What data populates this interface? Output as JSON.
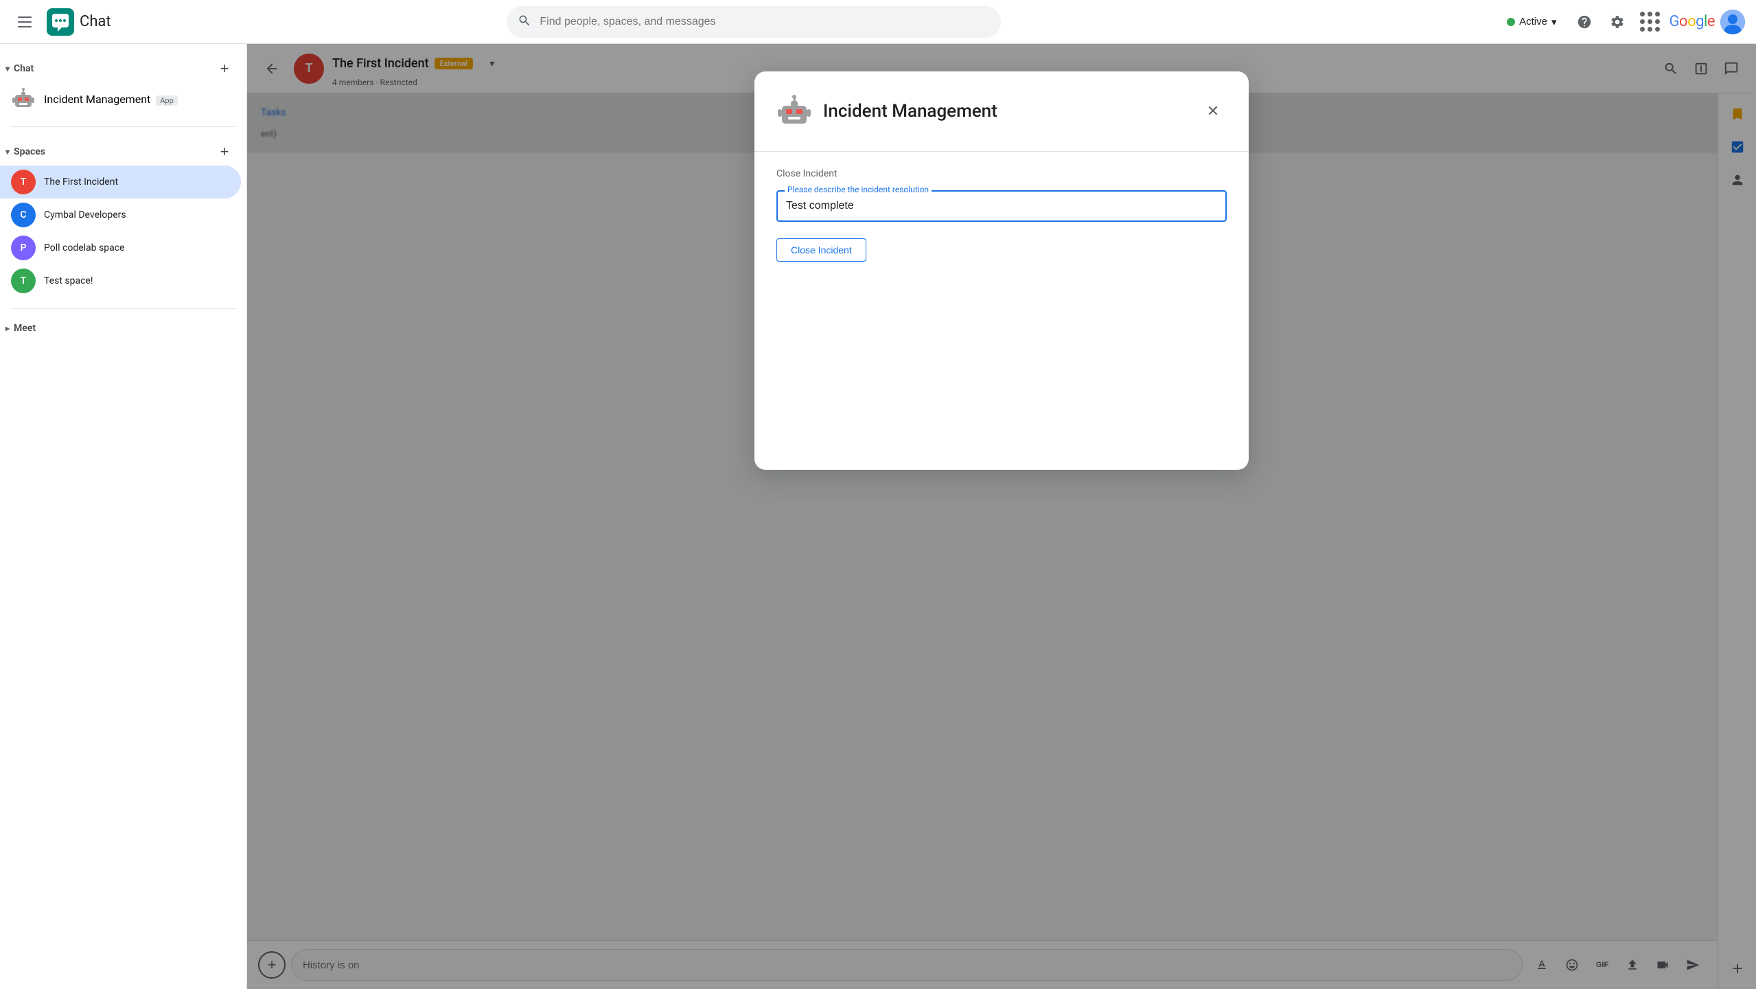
{
  "topbar": {
    "hamburger_label": "Menu",
    "app_name": "Chat",
    "search_placeholder": "Find people, spaces, and messages",
    "status_label": "Active",
    "help_label": "Help",
    "settings_label": "Settings",
    "apps_label": "Google apps",
    "google_label": "Google",
    "chevron_down": "▾"
  },
  "sidebar": {
    "chat_section": "Chat",
    "chat_add_label": "+",
    "chat_items": [
      {
        "name": "Incident Management",
        "sub": "App",
        "avatar_text": "🤖",
        "type": "app"
      }
    ],
    "spaces_section": "Spaces",
    "spaces_add_label": "+",
    "spaces_items": [
      {
        "name": "The First Incident",
        "avatar_text": "T",
        "color": "#ea4335",
        "active": true
      },
      {
        "name": "Cymbal Developers",
        "avatar_text": "C",
        "color": "#1a73e8",
        "active": false
      },
      {
        "name": "Poll codelab space",
        "avatar_text": "P",
        "color": "#7b61ff",
        "active": false
      },
      {
        "name": "Test space!",
        "avatar_text": "T",
        "color": "#34a853",
        "active": false
      }
    ],
    "meet_section": "Meet"
  },
  "chat_header": {
    "back_label": "←",
    "avatar_text": "T",
    "title": "The First Incident",
    "external_badge": "External",
    "sub_text": "4 members · Restricted",
    "search_label": "Search",
    "split_label": "Split",
    "chat_label": "Chat",
    "tasks_label": "Tasks"
  },
  "right_sidebar": {
    "checklist_label": "Checklist",
    "person_label": "Person",
    "add_label": "Add"
  },
  "message_input": {
    "placeholder": "History is on",
    "add_label": "+",
    "format_label": "A",
    "emoji_label": "😊",
    "gif_label": "GIF",
    "upload_label": "↑",
    "video_label": "📹",
    "send_label": "➤"
  },
  "dialog": {
    "title": "Incident Management",
    "close_label": "✕",
    "section_label": "Close Incident",
    "field_label": "Please describe the incident resolution",
    "field_value": "Test complete",
    "close_btn_label": "Close Incident"
  }
}
